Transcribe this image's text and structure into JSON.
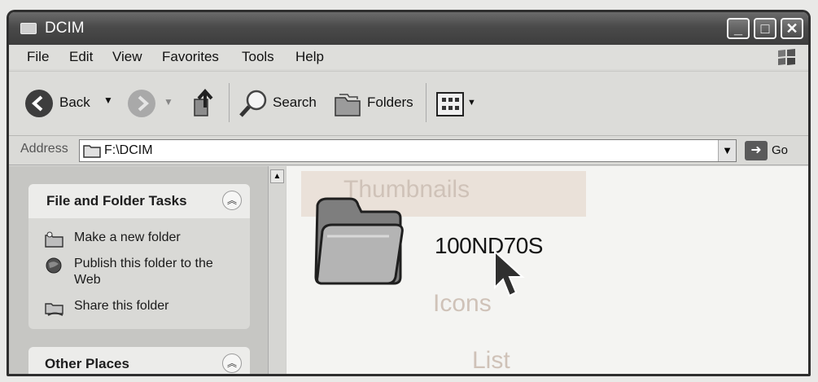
{
  "window": {
    "title": "DCIM",
    "minimize": "_",
    "maximize": "□",
    "close": "✕"
  },
  "menu": [
    "File",
    "Edit",
    "View",
    "Favorites",
    "Tools",
    "Help"
  ],
  "toolbar": {
    "back_label": "Back",
    "search_label": "Search",
    "folders_label": "Folders"
  },
  "address": {
    "label": "Address",
    "path": "F:\\DCIM",
    "go_label": "Go"
  },
  "tasks_panel": {
    "title": "File and Folder Tasks",
    "items": [
      {
        "icon": "new-folder-icon",
        "label": "Make a new folder"
      },
      {
        "icon": "globe-icon",
        "label": "Publish this folder to the Web"
      },
      {
        "icon": "share-folder-icon",
        "label": "Share this folder"
      }
    ]
  },
  "places_panel": {
    "title": "Other Places"
  },
  "files": [
    {
      "name": "100ND70S",
      "type": "folder"
    }
  ],
  "ghost_menu": {
    "items": [
      "Thumbnails",
      "Icons",
      "List"
    ]
  },
  "colors": {
    "titlebar": "#4a4a4a",
    "panel": "#d9d9d6",
    "content": "#f4f4f2"
  }
}
